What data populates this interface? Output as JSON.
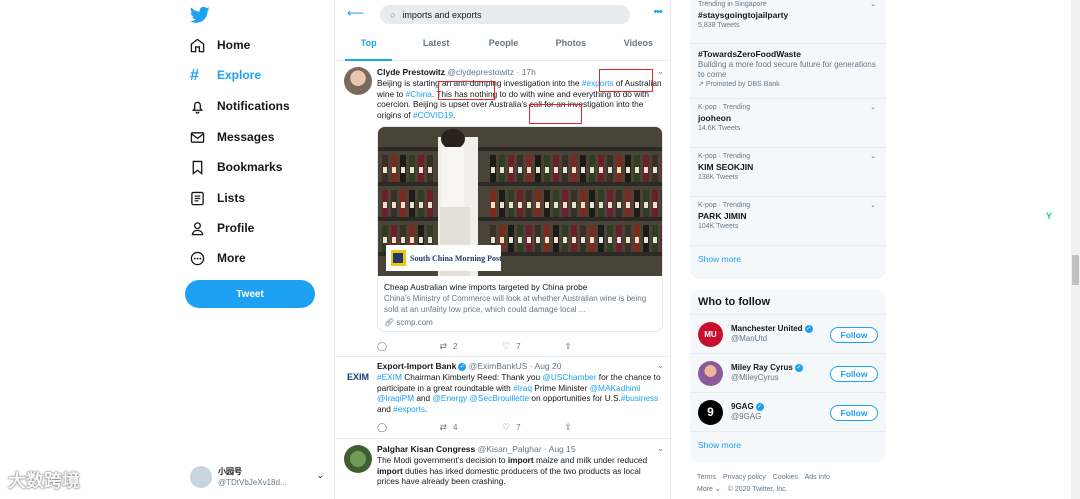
{
  "nav": {
    "items": [
      {
        "label": "Home",
        "icon": "home-icon"
      },
      {
        "label": "Explore",
        "icon": "hashtag-icon"
      },
      {
        "label": "Notifications",
        "icon": "bell-icon"
      },
      {
        "label": "Messages",
        "icon": "mail-icon"
      },
      {
        "label": "Bookmarks",
        "icon": "bookmark-icon"
      },
      {
        "label": "Lists",
        "icon": "list-icon"
      },
      {
        "label": "Profile",
        "icon": "person-icon"
      },
      {
        "label": "More",
        "icon": "more-circle-icon"
      }
    ],
    "tweet_label": "Tweet",
    "account_name": "小园号",
    "account_handle": "@TDtVbJeXv18d...",
    "watermark": "大数跨境"
  },
  "search": {
    "value": "imports and exports"
  },
  "tabs": [
    "Top",
    "Latest",
    "People",
    "Photos",
    "Videos"
  ],
  "tweets": [
    {
      "name": "Clyde Prestowitz",
      "handle": "@clydeprestowitz",
      "time": "· 17h",
      "text_parts": [
        {
          "t": "Beijing is starting an anti-dumping investigation into the "
        },
        {
          "t": "#exports",
          "hl": true
        },
        {
          "t": " of Australian wine to "
        },
        {
          "t": "#China",
          "hl": true
        },
        {
          "t": ". This has nothing to do with wine and everything to do with coercion. Beijing is upset over Australia’s call for an investigation into the origins of "
        },
        {
          "t": "#COVID19",
          "hl": true
        },
        {
          "t": "."
        }
      ],
      "card": {
        "source": "South China Morning Post",
        "title": "Cheap Australian wine imports targeted by China probe",
        "desc": "China’s Ministry of Commerce will look at whether Australian wine is being sold at an unfairly low price, which could damage local ...",
        "link": "scmp.com"
      },
      "replies": "",
      "retweets": "2",
      "likes": "7"
    },
    {
      "name": "Export-Import Bank",
      "handle": "@EximBankUS",
      "time": "· Aug 20",
      "text_parts": [
        {
          "t": "#EXIM",
          "hl": true
        },
        {
          "t": " Chairman Kimberly Reed: Thank you "
        },
        {
          "t": "@USChamber",
          "hl": true
        },
        {
          "t": " for the chance to participate in a great roundtable with "
        },
        {
          "t": "#Iraq",
          "hl": true
        },
        {
          "t": " Prime Minister "
        },
        {
          "t": "@MAKadhimi @IraqiPM",
          "hl": true
        },
        {
          "t": " and "
        },
        {
          "t": "@Energy @SecBrouillette",
          "hl": true
        },
        {
          "t": " on opportunities for U.S."
        },
        {
          "t": "#business",
          "hl": true
        },
        {
          "t": " and "
        },
        {
          "t": "#exports",
          "hl": true
        },
        {
          "t": "."
        }
      ],
      "avatar_text": "EXIM",
      "replies": "",
      "retweets": "4",
      "likes": "7"
    },
    {
      "name": "Palghar Kisan Congress",
      "handle": "@Kisan_Palghar",
      "time": "· Aug 15",
      "text_parts": [
        {
          "t": "The Modi government’s decision to "
        },
        {
          "t": "import",
          "b": true
        },
        {
          "t": " maize and milk under reduced "
        },
        {
          "t": "import",
          "b": true
        },
        {
          "t": " duties has irked domestic producers of the two products as local prices have already been crashing."
        }
      ]
    }
  ],
  "trends": [
    {
      "ctx": "Trending in Singapore",
      "title": "#staysgoingtojailparty",
      "desc": "",
      "count": "5,838 Tweets"
    },
    {
      "ctx": "",
      "title": "#TowardsZeroFoodWaste",
      "desc": "Building a more food secure future for generations to come",
      "count": "Promoted by DBS Bank"
    },
    {
      "ctx": "K-pop · Trending",
      "title": "jooheon",
      "desc": "",
      "count": "14.6K Tweets"
    },
    {
      "ctx": "K-pop · Trending",
      "title": "KIM SEOKJIN",
      "desc": "",
      "count": "138K Tweets"
    },
    {
      "ctx": "K-pop · Trending",
      "title": "PARK JIMIN",
      "desc": "",
      "count": "104K Tweets"
    }
  ],
  "show_more": "Show more",
  "who_to_follow": {
    "title": "Who to follow",
    "accounts": [
      {
        "name": "Manchester United",
        "handle": "@ManUtd",
        "color": "#c8102e",
        "mark": "MU"
      },
      {
        "name": "Miley Ray Cyrus",
        "handle": "@MileyCyrus",
        "color": "#8c5a9b",
        "mark": ""
      },
      {
        "name": "9GAG",
        "handle": "@9GAG",
        "color": "#000000",
        "mark": "9"
      }
    ],
    "follow_label": "Follow",
    "show_more": "Show more"
  },
  "footer": {
    "links": [
      "Terms",
      "Privacy policy",
      "Cookies",
      "Ads info"
    ],
    "more": "More ⌄",
    "copyright": "© 2020 Twitter, Inc."
  }
}
